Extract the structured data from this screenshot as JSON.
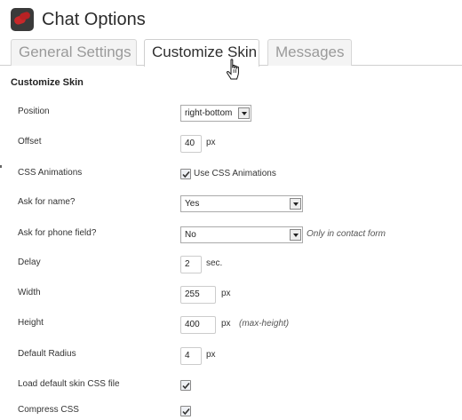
{
  "header": {
    "title": "Chat Options",
    "logo_icon": "chat-bubbles-logo-icon",
    "logo_color": "#c8282a"
  },
  "tabs": [
    {
      "label": "General Settings",
      "active": false
    },
    {
      "label": "Customize Skin",
      "active": true
    },
    {
      "label": "Messages",
      "active": false
    }
  ],
  "section": {
    "title": "Customize Skin"
  },
  "fields": {
    "position": {
      "label": "Position",
      "value": "right-bottom"
    },
    "offset": {
      "label": "Offset",
      "value": "40",
      "unit": "px"
    },
    "css_animations": {
      "label": "CSS Animations",
      "checked": true,
      "checkbox_label": "Use CSS Animations"
    },
    "ask_name": {
      "label": "Ask for name?",
      "value": "Yes"
    },
    "ask_phone": {
      "label": "Ask for phone field?",
      "value": "No",
      "note": "Only in contact form"
    },
    "delay": {
      "label": "Delay",
      "value": "2",
      "unit": "sec."
    },
    "width": {
      "label": "Width",
      "value": "255",
      "unit": "px"
    },
    "height": {
      "label": "Height",
      "value": "400",
      "unit": "px",
      "note": "(max-height)"
    },
    "radius": {
      "label": "Default Radius",
      "value": "4",
      "unit": "px"
    },
    "load_css": {
      "label": "Load default skin CSS file",
      "checked": true
    },
    "compress_css": {
      "label": "Compress CSS",
      "checked": true
    }
  }
}
